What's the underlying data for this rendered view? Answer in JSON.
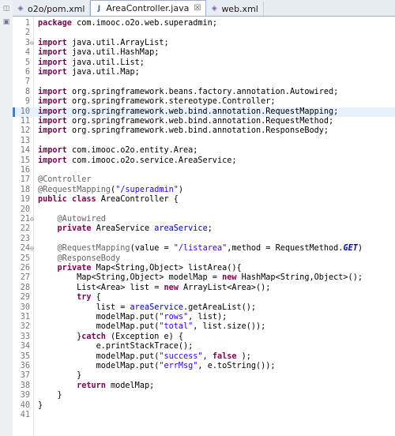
{
  "tabs": [
    {
      "label": "o2o/pom.xml",
      "icon": "xml-file-icon",
      "active": false
    },
    {
      "label": "AreaController.java",
      "icon": "java-file-icon",
      "active": true,
      "close": "☒"
    },
    {
      "label": "web.xml",
      "icon": "xml-file-icon",
      "active": false
    }
  ],
  "current_line": 10,
  "lines": [
    {
      "n": "1",
      "segs": [
        [
          "kw",
          "package"
        ],
        [
          "",
          "com.imooc.o2o.web.superadmin;"
        ]
      ]
    },
    {
      "n": "2",
      "segs": []
    },
    {
      "n": "3",
      "fold": "⊖",
      "segs": [
        [
          "kw",
          "import"
        ],
        [
          "",
          "java.util.ArrayList;"
        ]
      ]
    },
    {
      "n": "4",
      "segs": [
        [
          "kw",
          "import"
        ],
        [
          "",
          "java.util.HashMap;"
        ]
      ]
    },
    {
      "n": "5",
      "segs": [
        [
          "kw",
          "import"
        ],
        [
          "",
          "java.util.List;"
        ]
      ]
    },
    {
      "n": "6",
      "segs": [
        [
          "kw",
          "import"
        ],
        [
          "",
          "java.util.Map;"
        ]
      ]
    },
    {
      "n": "7",
      "segs": []
    },
    {
      "n": "8",
      "segs": [
        [
          "kw",
          "import"
        ],
        [
          "",
          "org.springframework.beans.factory.annotation.Autowired;"
        ]
      ]
    },
    {
      "n": "9",
      "segs": [
        [
          "kw",
          "import"
        ],
        [
          "",
          "org.springframework.stereotype.Controller;"
        ]
      ]
    },
    {
      "n": "10",
      "segs": [
        [
          "kw",
          "import"
        ],
        [
          "",
          "org.springframework.web.bind.annotation.RequestMapping;"
        ]
      ]
    },
    {
      "n": "11",
      "segs": [
        [
          "kw",
          "import"
        ],
        [
          "",
          "org.springframework.web.bind.annotation.RequestMethod;"
        ]
      ]
    },
    {
      "n": "12",
      "segs": [
        [
          "kw",
          "import"
        ],
        [
          "",
          "org.springframework.web.bind.annotation.ResponseBody;"
        ]
      ]
    },
    {
      "n": "13",
      "segs": []
    },
    {
      "n": "14",
      "segs": [
        [
          "kw",
          "import"
        ],
        [
          "",
          "com.imooc.o2o.entity.Area;"
        ]
      ]
    },
    {
      "n": "15",
      "segs": [
        [
          "kw",
          "import"
        ],
        [
          "",
          "com.imooc.o2o.service.AreaService;"
        ]
      ]
    },
    {
      "n": "16",
      "segs": []
    },
    {
      "n": "17",
      "segs": [
        [
          "ann",
          "@Controller"
        ]
      ]
    },
    {
      "n": "18",
      "segs": [
        [
          "ann",
          "@RequestMapping"
        ],
        [
          "",
          "("
        ],
        [
          "str",
          "\"/superadmin\""
        ],
        [
          "",
          ")"
        ]
      ]
    },
    {
      "n": "19",
      "segs": [
        [
          "kw",
          "public"
        ],
        [
          "",
          ""
        ],
        [
          "kw",
          "class"
        ],
        [
          "",
          "AreaController {"
        ]
      ]
    },
    {
      "n": "20",
      "segs": []
    },
    {
      "n": "21",
      "fold": "⊖",
      "segs": [
        [
          "",
          "    "
        ],
        [
          "ann",
          "@Autowired"
        ]
      ]
    },
    {
      "n": "22",
      "segs": [
        [
          "",
          "    "
        ],
        [
          "kw",
          "private"
        ],
        [
          "",
          "AreaService "
        ],
        [
          "fld",
          "areaService"
        ],
        [
          "",
          ";"
        ]
      ]
    },
    {
      "n": "23",
      "segs": []
    },
    {
      "n": "24",
      "fold": "⊖",
      "segs": [
        [
          "",
          "    "
        ],
        [
          "ann",
          "@RequestMapping"
        ],
        [
          "",
          "(value = "
        ],
        [
          "str",
          "\"/listarea\""
        ],
        [
          "",
          ",method = RequestMethod."
        ],
        [
          "ital",
          "GET"
        ],
        [
          "",
          ")"
        ]
      ]
    },
    {
      "n": "25",
      "segs": [
        [
          "",
          "    "
        ],
        [
          "ann",
          "@ResponseBody"
        ]
      ]
    },
    {
      "n": "26",
      "segs": [
        [
          "",
          "    "
        ],
        [
          "kw",
          "private"
        ],
        [
          "",
          "Map<String,Object> listArea(){"
        ]
      ]
    },
    {
      "n": "27",
      "segs": [
        [
          "",
          "        Map<String,Object> modelMap = "
        ],
        [
          "kw",
          "new"
        ],
        [
          "",
          "HashMap<String,Object>();"
        ]
      ]
    },
    {
      "n": "28",
      "segs": [
        [
          "",
          "        List<Area> list = "
        ],
        [
          "kw",
          "new"
        ],
        [
          "",
          "ArrayList<Area>();"
        ]
      ]
    },
    {
      "n": "29",
      "segs": [
        [
          "",
          "        "
        ],
        [
          "kw",
          "try"
        ],
        [
          "",
          "{"
        ]
      ]
    },
    {
      "n": "30",
      "segs": [
        [
          "",
          "            list = "
        ],
        [
          "fld",
          "areaService"
        ],
        [
          "",
          ".getAreaList();"
        ]
      ]
    },
    {
      "n": "31",
      "segs": [
        [
          "",
          "            modelMap.put("
        ],
        [
          "str",
          "\"rows\""
        ],
        [
          "",
          ", list);"
        ]
      ]
    },
    {
      "n": "32",
      "segs": [
        [
          "",
          "            modelMap.put("
        ],
        [
          "str",
          "\"total\""
        ],
        [
          "",
          ", list.size());"
        ]
      ]
    },
    {
      "n": "33",
      "segs": [
        [
          "",
          "        }"
        ],
        [
          "kw",
          "catch"
        ],
        [
          "",
          "(Exception e) {"
        ]
      ]
    },
    {
      "n": "34",
      "segs": [
        [
          "",
          "            e.printStackTrace();"
        ]
      ]
    },
    {
      "n": "35",
      "segs": [
        [
          "",
          "            modelMap.put("
        ],
        [
          "str",
          "\"success\""
        ],
        [
          "",
          ", "
        ],
        [
          "kw",
          "false"
        ],
        [
          "",
          ");"
        ]
      ]
    },
    {
      "n": "36",
      "segs": [
        [
          "",
          "            modelMap.put("
        ],
        [
          "str",
          "\"errMsg\""
        ],
        [
          "",
          ", e.toString());"
        ]
      ]
    },
    {
      "n": "37",
      "segs": [
        [
          "",
          "        }"
        ]
      ]
    },
    {
      "n": "38",
      "segs": [
        [
          "",
          "        "
        ],
        [
          "kw",
          "return"
        ],
        [
          "",
          "modelMap;"
        ]
      ]
    },
    {
      "n": "39",
      "segs": [
        [
          "",
          "    }"
        ]
      ]
    },
    {
      "n": "40",
      "segs": [
        [
          "",
          "}"
        ]
      ]
    },
    {
      "n": "41",
      "segs": []
    }
  ]
}
